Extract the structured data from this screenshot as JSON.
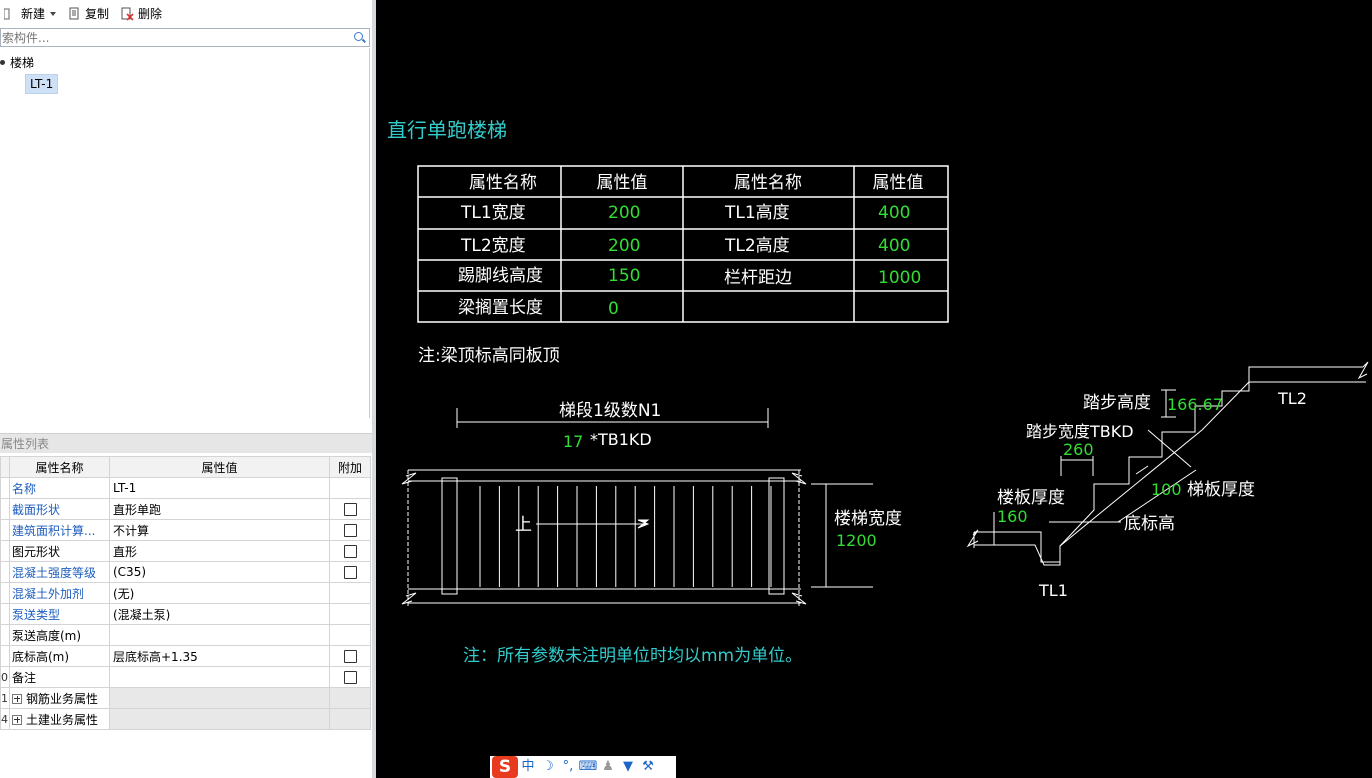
{
  "toolbar": {
    "new_label": "新建",
    "copy_label": "复制",
    "delete_label": "删除"
  },
  "search": {
    "placeholder": "索构件..."
  },
  "tree": {
    "root_label": "楼梯",
    "leaf_label": "LT-1"
  },
  "props": {
    "header": "属性列表",
    "col_name": "属性名称",
    "col_value": "属性值",
    "col_extra": "附加",
    "rows": [
      {
        "num": "",
        "name": "名称",
        "value": "LT-1"
      },
      {
        "num": "",
        "name": "截面形状",
        "value": "直形单跑"
      },
      {
        "num": "",
        "name": "建筑面积计算...",
        "value": "不计算"
      },
      {
        "num": "",
        "name": "图元形状",
        "value": "直形"
      },
      {
        "num": "",
        "name": "混凝土强度等级",
        "value": "(C35)"
      },
      {
        "num": "",
        "name": "混凝土外加剂",
        "value": "(无)"
      },
      {
        "num": "",
        "name": "泵送类型",
        "value": "(混凝土泵)"
      },
      {
        "num": "",
        "name": "泵送高度(m)",
        "value": ""
      },
      {
        "num": "",
        "name": "底标高(m)",
        "value": "层底标高+1.35"
      },
      {
        "num": "0",
        "name": "备注",
        "value": ""
      },
      {
        "num": "1",
        "name": "钢筋业务属性",
        "value": ""
      },
      {
        "num": "4",
        "name": "土建业务属性",
        "value": ""
      }
    ]
  },
  "drawing": {
    "title": "直行单跑楼梯",
    "table": {
      "h1": "属性名称",
      "h2": "属性值",
      "h3": "属性名称",
      "h4": "属性值",
      "r1c1": "TL1宽度",
      "r1c2": "200",
      "r1c3": "TL1高度",
      "r1c4": "400",
      "r2c1": "TL2宽度",
      "r2c2": "200",
      "r2c3": "TL2高度",
      "r2c4": "400",
      "r3c1": "踢脚线高度",
      "r3c2": "150",
      "r3c3": "栏杆距边",
      "r3c4": "1000",
      "r4c1": "梁搁置长度",
      "r4c2": "0"
    },
    "note1": "注:梁顶标高同板顶",
    "plan": {
      "steps_label": "梯段1级数N1",
      "steps_value": "17",
      "steps_expr": "*TB1KD",
      "up_label": "上",
      "width_label": "楼梯宽度",
      "width_value": "1200"
    },
    "section": {
      "step_height_label": "踏步高度",
      "step_height_value": "166.67",
      "step_width_label": "踏步宽度TBKD",
      "step_width_value": "260",
      "slab_thk_label": "楼板厚度",
      "slab_thk_value": "160",
      "stair_thk_value": "100",
      "stair_thk_label": "梯板厚度",
      "bottom_elev_label": "底标高",
      "tl1": "TL1",
      "tl2": "TL2"
    },
    "note2": "注：所有参数未注明单位时均以mm为单位。"
  },
  "ime": {
    "zh": "中",
    "logo": "S"
  },
  "colors": {
    "cad_text": "#ffffff",
    "cad_value": "#33dd33",
    "cad_title": "#33cccc",
    "bg": "#000000"
  }
}
